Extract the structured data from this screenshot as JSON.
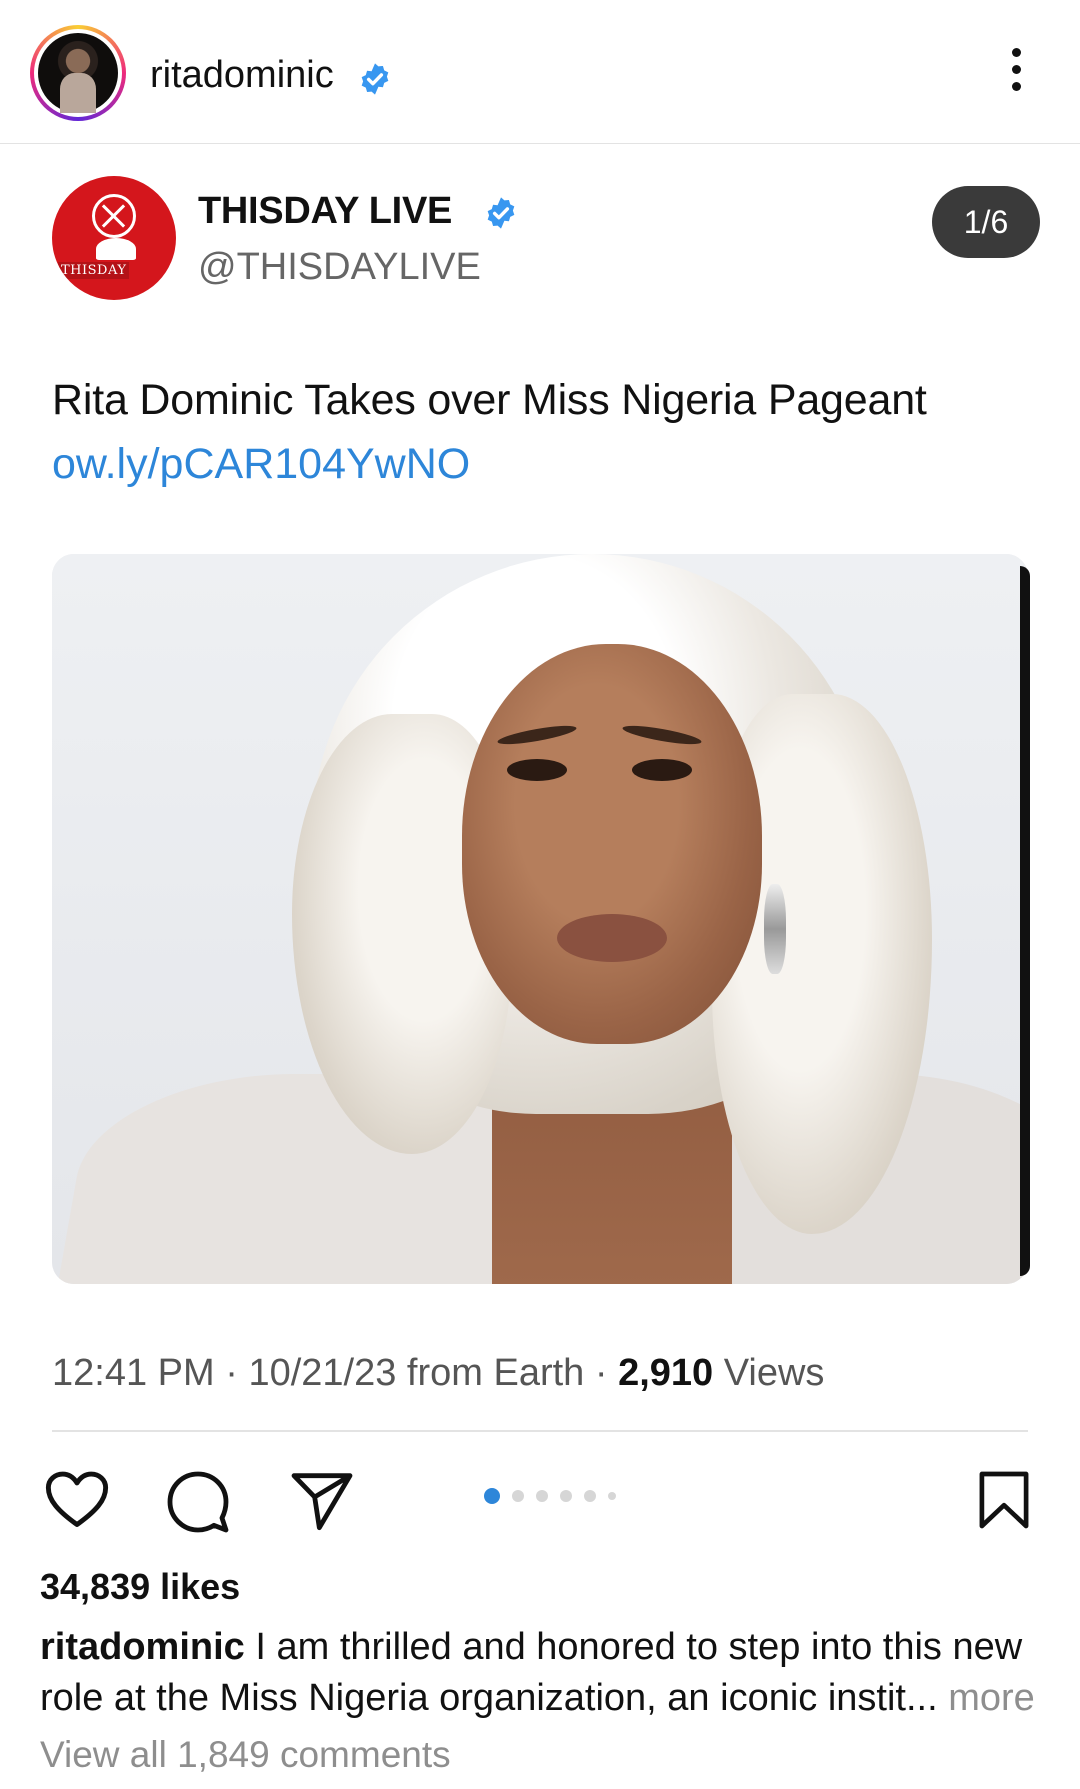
{
  "header": {
    "username": "ritadominic",
    "verified": true
  },
  "tweet": {
    "display_name": "THISDAY LIVE",
    "handle": "@THISDAYLIVE",
    "avatar_text": "THISDAY",
    "slide_counter": "1/6",
    "text": "Rita Dominic Takes over Miss Nigeria Pageant",
    "link": "ow.ly/pCAR104YwNO",
    "time": "12:41 PM",
    "date": "10/21/23",
    "source": "from Earth",
    "views_count": "2,910",
    "views_label": "Views"
  },
  "actions": {
    "like_icon": "heart-icon",
    "comment_icon": "comment-icon",
    "share_icon": "send-icon",
    "save_icon": "bookmark-icon",
    "carousel_dots": 6,
    "active_dot": 0
  },
  "post": {
    "likes": "34,839 likes",
    "caption_user": "ritadominic",
    "caption_text": "I am thrilled and honored to step into this new role at the Miss Nigeria organization, an iconic instit...",
    "more_label": " more",
    "view_comments": "View all 1,849 comments"
  },
  "colors": {
    "accent_blue": "#2d86d9",
    "verified_blue": "#3897f0",
    "thisday_red": "#d4161c"
  }
}
